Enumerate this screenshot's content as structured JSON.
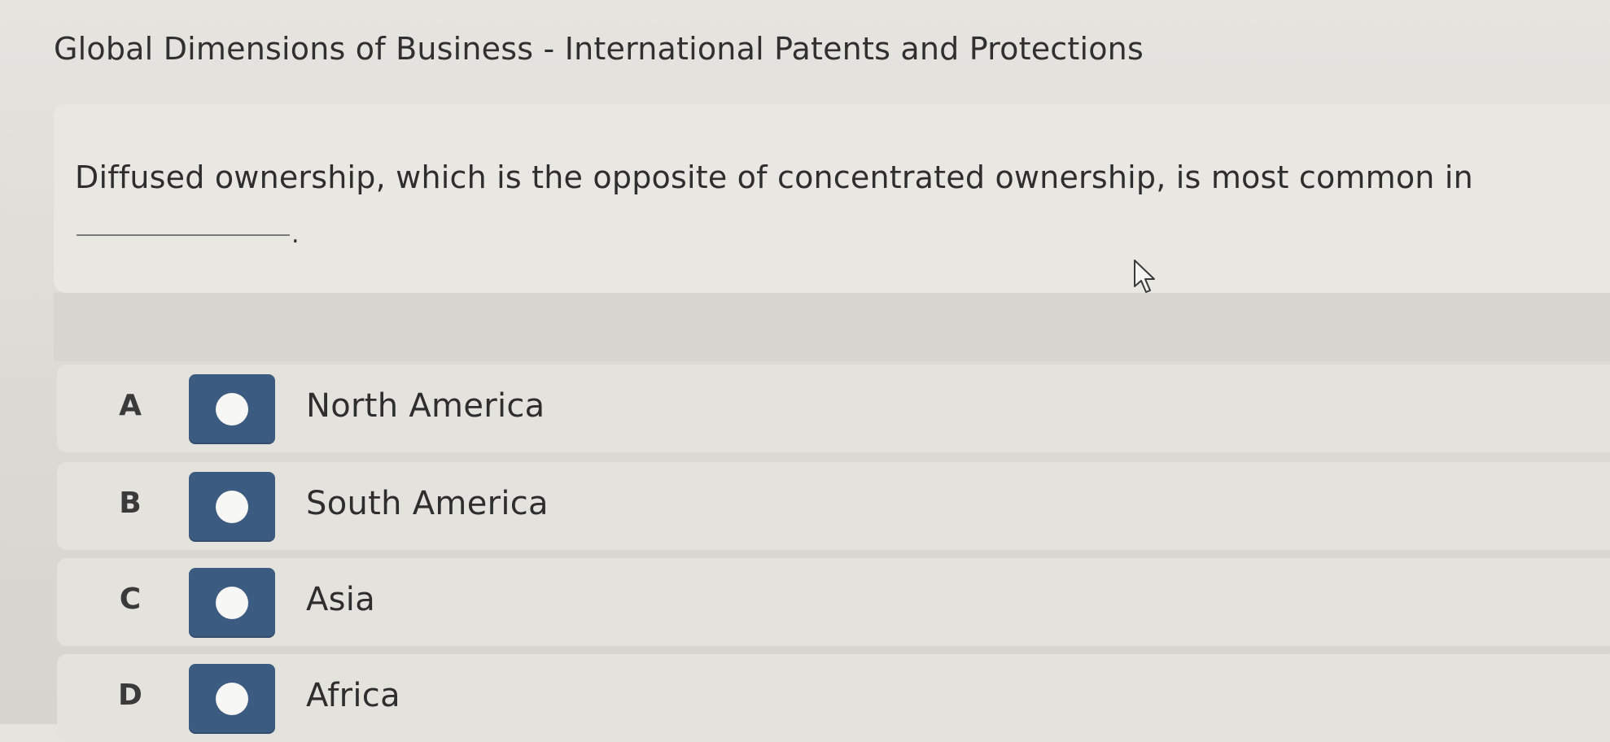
{
  "header": {
    "title": "Global Dimensions of Business - International Patents and Protections"
  },
  "question": {
    "text": "Diffused ownership, which is the opposite of concentrated ownership, is most common in",
    "blank_suffix": "."
  },
  "options": [
    {
      "letter": "A",
      "label": "North America",
      "selected": false
    },
    {
      "letter": "B",
      "label": "South America",
      "selected": false
    },
    {
      "letter": "C",
      "label": "Asia",
      "selected": false
    },
    {
      "letter": "D",
      "label": "Africa",
      "selected": false
    }
  ],
  "colors": {
    "radio_background": "#3b5b80",
    "radio_dot": "#f7f7f5",
    "page_background": "#e3e1dc"
  },
  "icons": {
    "cursor": "mouse-pointer-icon",
    "radio": "radio-button-icon"
  }
}
